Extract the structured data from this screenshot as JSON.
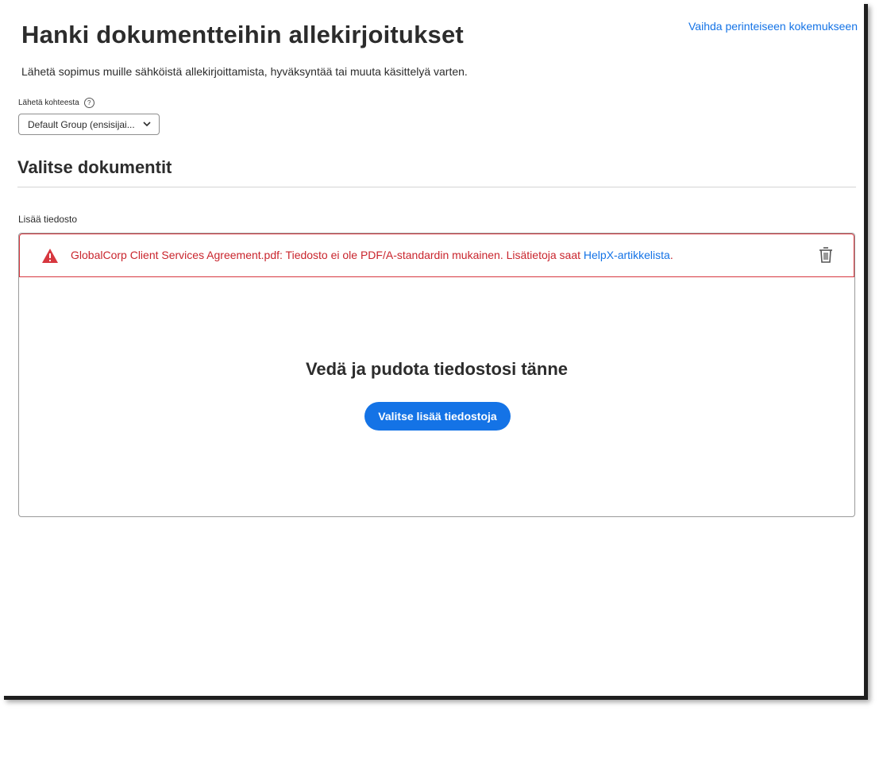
{
  "header": {
    "switch_link": "Vaihda perinteiseen kokemukseen",
    "title": "Hanki dokumentteihin allekirjoitukset",
    "subtitle": "Lähetä sopimus muille sähköistä allekirjoittamista, hyväksyntää tai muuta käsittelyä varten."
  },
  "send_from": {
    "label": "Lähetä kohteesta",
    "selected": "Default Group (ensisijai..."
  },
  "documents": {
    "section_title": "Valitse dokumentit",
    "add_file_label": "Lisää tiedosto",
    "error": {
      "message": "GlobalCorp Client Services Agreement.pdf: Tiedosto ei ole PDF/A-standardin mukainen. Lisätietoja saat ",
      "link_text": "HelpX-artikkelista",
      "suffix": "."
    },
    "drop_text": "Vedä ja pudota tiedostosi tänne",
    "choose_button": "Valitse lisää tiedostoja"
  },
  "colors": {
    "accent": "#1473e6",
    "error": "#d7373f"
  },
  "icons": [
    "help-icon",
    "chevron-down-icon",
    "warning-icon",
    "trash-icon"
  ]
}
